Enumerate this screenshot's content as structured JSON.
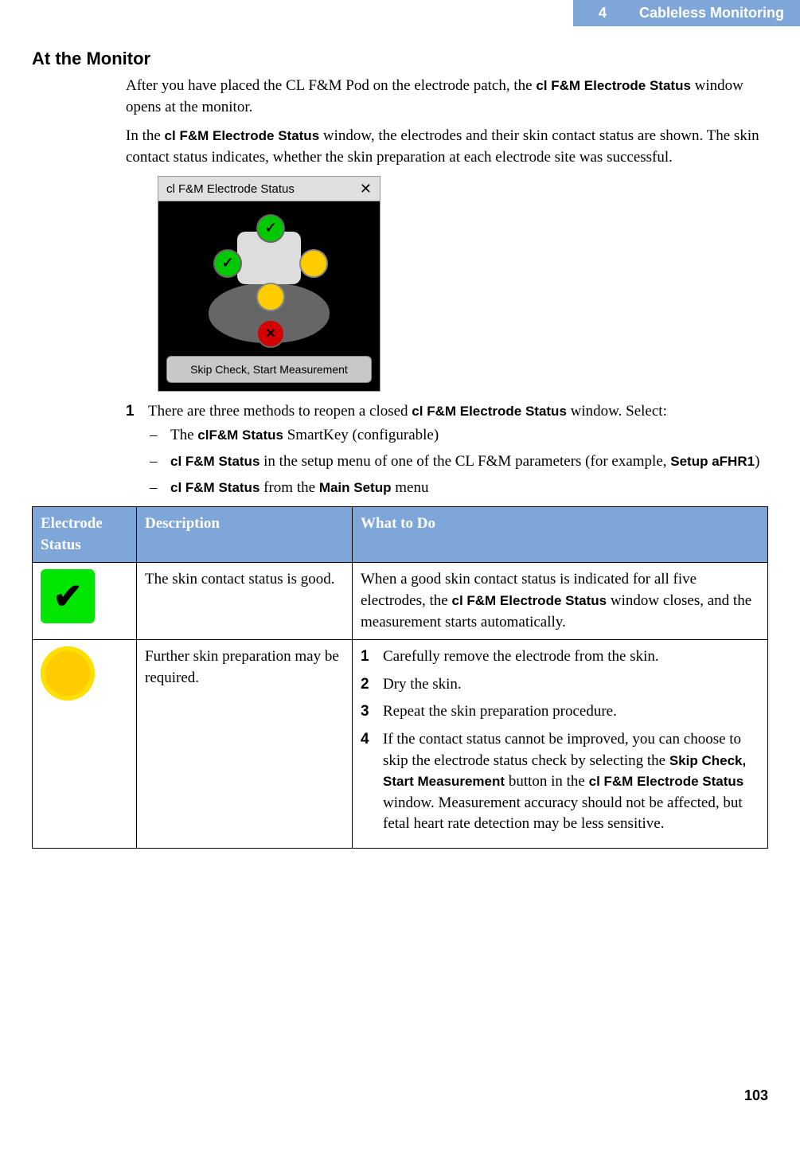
{
  "header": {
    "chapter_num": "4",
    "chapter_title": "Cableless Monitoring"
  },
  "section_title": "At the Monitor",
  "para1_a": "After you have placed the CL F&M Pod on the electrode patch, the ",
  "para1_b_bold": "cl F&M Electrode Status",
  "para1_c": " window opens at the monitor.",
  "para2_a": "In the ",
  "para2_b_bold": "cl F&M Electrode Status",
  "para2_c": " window, the electrodes and their skin contact status are shown. The skin contact status indicates, whether the skin preparation at each electrode site was successful.",
  "screenshot": {
    "title": "cl F&M Electrode Status",
    "button": "Skip Check, Start Measurement"
  },
  "step1": {
    "num": "1",
    "text_a": "There are three methods to reopen a closed ",
    "text_b_bold": "cl F&M Electrode Status",
    "text_c": " window. Select:"
  },
  "bullets": {
    "b1_a": "The ",
    "b1_b_bold": "clF&M Status",
    "b1_c": " SmartKey (configurable)",
    "b2_a_bold": "cl F&M Status",
    "b2_b": " in the setup menu of one of the CL F&M parameters (for example, ",
    "b2_c_bold": "Setup aFHR1",
    "b2_d": ")",
    "b3_a_bold": "cl F&M Status",
    "b3_b": " from the ",
    "b3_c_bold": "Main Setup",
    "b3_d": " menu"
  },
  "table": {
    "h1": "Electrode Status",
    "h2": "Description",
    "h3": "What to Do",
    "row1": {
      "desc": "The skin contact status is good.",
      "do_a": "When a good skin contact status is indicated for all five electrodes, the ",
      "do_b_bold": "cl F&M Electrode Status",
      "do_c": " window closes, and the measurement starts automatically."
    },
    "row2": {
      "desc": "Further skin preparation may be required.",
      "s1n": "1",
      "s1": "Carefully remove the electrode from the skin.",
      "s2n": "2",
      "s2": "Dry the skin.",
      "s3n": "3",
      "s3": "Repeat the skin preparation procedure.",
      "s4n": "4",
      "s4_a": "If the contact status cannot be improved, you can choose to skip the electrode status check by selecting the ",
      "s4_b_bold": "Skip Check, Start Measurement",
      "s4_c": " button in the ",
      "s4_d_bold": "cl F&M Electrode Status",
      "s4_e": " window. Measurement accuracy should not be affected, but fetal heart rate detection may be less sensitive."
    }
  },
  "page_number": "103"
}
